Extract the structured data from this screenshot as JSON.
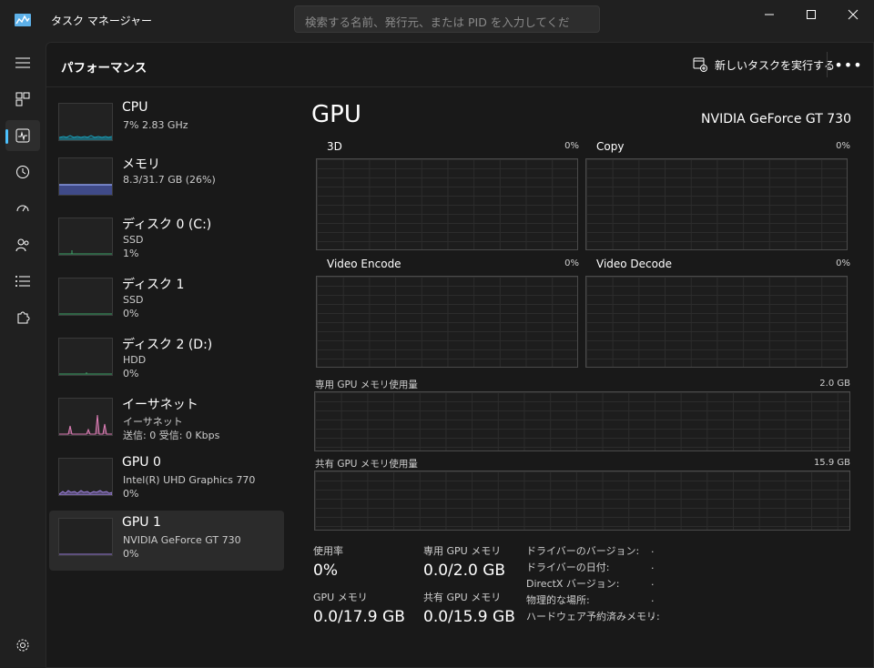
{
  "window": {
    "title": "タスク マネージャー",
    "search_placeholder": "検索する名前、発行元、または PID を入力してくだ"
  },
  "nav": {
    "items": [
      {
        "name": "processes",
        "icon": "hamburger-menu-icon"
      },
      {
        "name": "processes-view",
        "icon": "processes-grid-icon"
      },
      {
        "name": "performance",
        "icon": "performance-monitor-icon",
        "active": true
      },
      {
        "name": "app-history",
        "icon": "history-icon"
      },
      {
        "name": "startup",
        "icon": "startup-gauge-icon"
      },
      {
        "name": "users",
        "icon": "users-icon"
      },
      {
        "name": "details",
        "icon": "details-list-icon"
      },
      {
        "name": "services",
        "icon": "services-puzzle-icon"
      }
    ],
    "settings_icon": "settings-gear-icon"
  },
  "header": {
    "title": "パフォーマンス",
    "run_task_label": "新しいタスクを実行する",
    "more_label": "•••"
  },
  "devices": [
    {
      "name": "CPU",
      "line1": "7%  2.83 GHz",
      "line2": "",
      "graph_color": "#17a7c4"
    },
    {
      "name": "メモリ",
      "line1": "8.3/31.7 GB (26%)",
      "line2": "",
      "graph_color": "#8a9be8"
    },
    {
      "name": "ディスク 0 (C:)",
      "line1": "SSD",
      "line2": "1%",
      "graph_color": "#3fa66a"
    },
    {
      "name": "ディスク 1",
      "line1": "SSD",
      "line2": "0%",
      "graph_color": "#3fa66a"
    },
    {
      "name": "ディスク 2 (D:)",
      "line1": "HDD",
      "line2": "0%",
      "graph_color": "#3fa66a"
    },
    {
      "name": "イーサネット",
      "line1": "イーサネット",
      "line2": "送信: 0 受信: 0 Kbps",
      "graph_color": "#e07fb8"
    },
    {
      "name": "GPU 0",
      "line1": "Intel(R) UHD Graphics 770",
      "line2": "0%",
      "graph_color": "#9a7fd8"
    },
    {
      "name": "GPU 1",
      "line1": "NVIDIA GeForce GT 730",
      "line2": "0%",
      "graph_color": "#9a7fd8",
      "selected": true
    }
  ],
  "detail": {
    "title": "GPU",
    "model": "NVIDIA GeForce GT 730",
    "engines": [
      {
        "label": "3D",
        "percent": "0%"
      },
      {
        "label": "Copy",
        "percent": "0%"
      },
      {
        "label": "Video Encode",
        "percent": "0%"
      },
      {
        "label": "Video Decode",
        "percent": "0%"
      }
    ],
    "dedicated_mem": {
      "label": "専用 GPU メモリ使用量",
      "max": "2.0 GB"
    },
    "shared_mem": {
      "label": "共有 GPU メモリ使用量",
      "max": "15.9 GB"
    },
    "stats": {
      "usage_label": "使用率",
      "usage_value": "0%",
      "dedicated_label": "専用 GPU メモリ",
      "dedicated_value": "0.0/2.0 GB",
      "gpu_mem_label": "GPU メモリ",
      "gpu_mem_value": "0.0/17.9 GB",
      "shared_label": "共有 GPU メモリ",
      "shared_value": "0.0/15.9 GB"
    },
    "info": [
      {
        "label": "ドライバーのバージョン:",
        "value": "."
      },
      {
        "label": "ドライバーの日付:",
        "value": "."
      },
      {
        "label": "DirectX バージョン:",
        "value": "."
      },
      {
        "label": "物理的な場所:",
        "value": "."
      },
      {
        "label": "ハードウェア予約済みメモリ:",
        "value": "."
      }
    ]
  },
  "colors": {
    "accent": "#4cc2ff",
    "background": "#202020",
    "panel": "#191919"
  }
}
